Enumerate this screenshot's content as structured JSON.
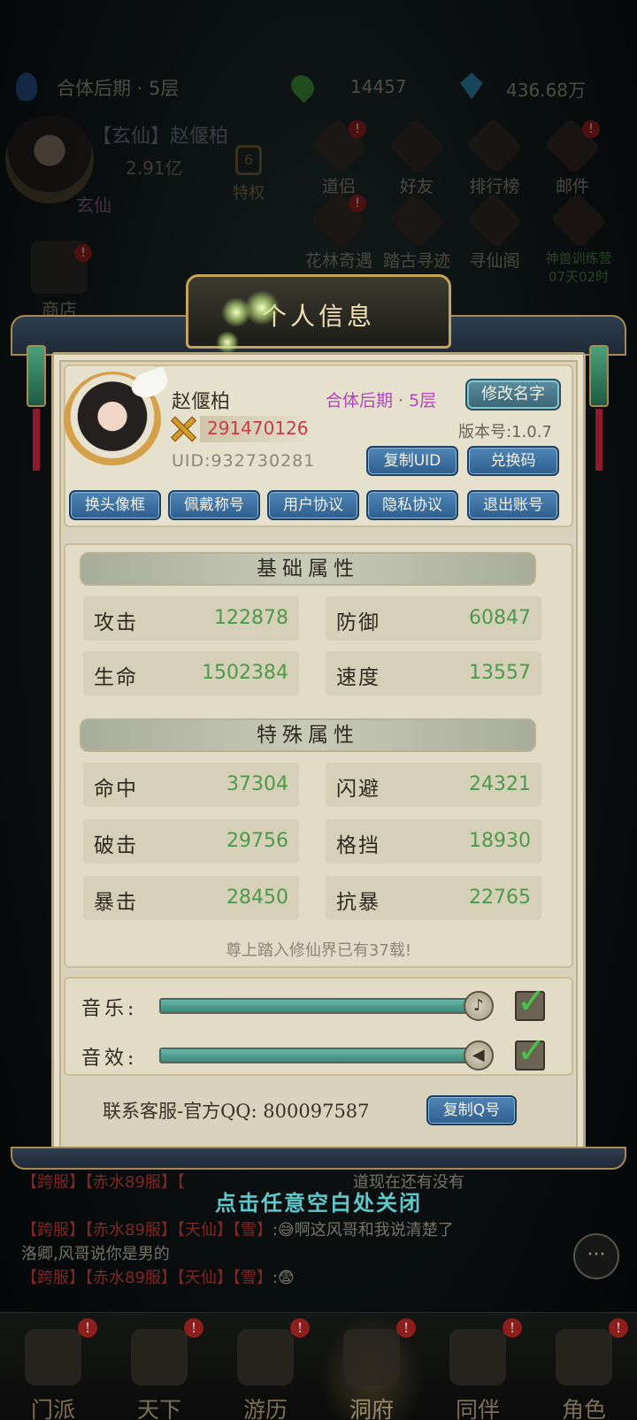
{
  "hud": {
    "realm": "合体后期 · 5层",
    "jade": "14457",
    "spirit_stones": "436.68万",
    "player_name": "【玄仙】赵偃柏",
    "power": "2.91亿",
    "rank": "玄仙",
    "vip_label": "特权",
    "vip_level": "6"
  },
  "menu": [
    {
      "label": "道侣",
      "badge": "!"
    },
    {
      "label": "好友",
      "badge": ""
    },
    {
      "label": "排行榜",
      "badge": ""
    },
    {
      "label": "邮件",
      "badge": "!"
    },
    {
      "label": "花林奇遇",
      "badge": "!"
    },
    {
      "label": "踏古寻迹",
      "badge": ""
    },
    {
      "label": "寻仙阁",
      "badge": ""
    },
    {
      "label": "神兽训练营",
      "badge": "",
      "timer": "07天02时"
    }
  ],
  "shop": {
    "label": "商店",
    "badge": "!"
  },
  "panel": {
    "title": "个人信息",
    "name": "赵偃柏",
    "realm": "合体后期 · 5层",
    "power": "291470126",
    "version": "版本号:1.0.7",
    "uid": "UID:932730281",
    "buttons": {
      "rename": "修改名字",
      "copy_uid": "复制UID",
      "redeem": "兑换码",
      "frame": "换头像框",
      "title": "佩戴称号",
      "user_agreement": "用户协议",
      "privacy": "隐私协议",
      "logout": "退出账号",
      "copy_qq": "复制Q号"
    },
    "basic_title": "基础属性",
    "basic": [
      {
        "label": "攻击",
        "value": "122878"
      },
      {
        "label": "防御",
        "value": "60847"
      },
      {
        "label": "生命",
        "value": "1502384"
      },
      {
        "label": "速度",
        "value": "13557"
      }
    ],
    "special_title": "特殊属性",
    "special": [
      {
        "label": "命中",
        "value": "37304"
      },
      {
        "label": "闪避",
        "value": "24321"
      },
      {
        "label": "破击",
        "value": "29756"
      },
      {
        "label": "格挡",
        "value": "18930"
      },
      {
        "label": "暴击",
        "value": "28450"
      },
      {
        "label": "抗暴",
        "value": "22765"
      }
    ],
    "flavor": "尊上踏入修仙界已有37载!",
    "music_label": "音乐:",
    "music_level": 0.97,
    "music_on": true,
    "sfx_label": "音效:",
    "sfx_level": 0.97,
    "sfx_on": true,
    "contact": "联系客服-官方QQ: 800097587"
  },
  "close_hint": "点击任意空白处关闭",
  "chat": {
    "line1": {
      "tags": "【跨服】【赤水89服】【",
      "text": "道现在还有没有"
    },
    "line2": {
      "tags": "【跨服】【赤水89服】【天仙】【雪】",
      "text": ":😅啊这风哥和我说清楚了"
    },
    "line3": {
      "text": "洛卿,风哥说你是男的"
    },
    "line4": {
      "tags": "【跨服】【赤水89服】【天仙】【雪】",
      "text": ":😨"
    },
    "bubble": "···"
  },
  "nav": [
    {
      "label": "门派",
      "badge": "!"
    },
    {
      "label": "天下",
      "badge": "!"
    },
    {
      "label": "游历",
      "badge": "!"
    },
    {
      "label": "洞府",
      "badge": "!"
    },
    {
      "label": "同伴",
      "badge": "!"
    },
    {
      "label": "角色",
      "badge": "!"
    }
  ],
  "colors": {
    "stat_value": "#4c9a4a",
    "power": "#c83c46",
    "realm_tag": "#b046b8",
    "close_hint": "#5fc8cb"
  }
}
